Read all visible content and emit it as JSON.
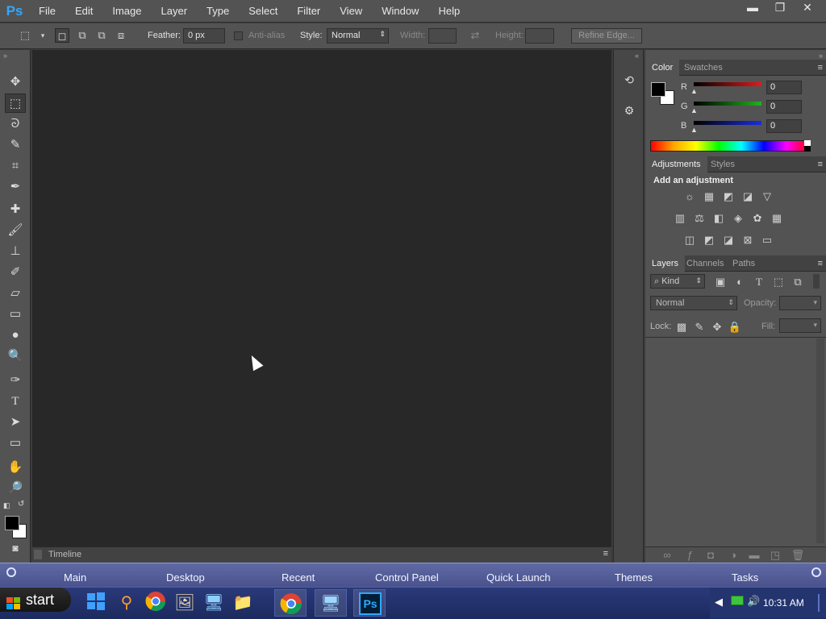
{
  "app": {
    "logo": "Ps"
  },
  "menu": [
    "File",
    "Edit",
    "Image",
    "Layer",
    "Type",
    "Select",
    "Filter",
    "View",
    "Window",
    "Help"
  ],
  "window_controls": {
    "minimize": "▬",
    "restore": "❐",
    "close": "✕"
  },
  "options": {
    "feather_label": "Feather:",
    "feather_value": "0 px",
    "antialias_label": "Anti-alias",
    "style_label": "Style:",
    "style_value": "Normal",
    "width_label": "Width:",
    "height_label": "Height:",
    "refine_edge": "Refine Edge..."
  },
  "timeline": {
    "label": "Timeline"
  },
  "color_panel": {
    "tabs": [
      "Color",
      "Swatches"
    ],
    "channels": [
      {
        "name": "R",
        "value": "0",
        "color": "#e21a1a"
      },
      {
        "name": "G",
        "value": "0",
        "color": "#22b11c"
      },
      {
        "name": "B",
        "value": "0",
        "color": "#1a2de0"
      }
    ]
  },
  "adjustments_panel": {
    "tabs": [
      "Adjustments",
      "Styles"
    ],
    "heading": "Add an adjustment"
  },
  "layers_panel": {
    "tabs": [
      "Layers",
      "Channels",
      "Paths"
    ],
    "kind_label": "Kind",
    "blend_mode": "Normal",
    "opacity_label": "Opacity:",
    "lock_label": "Lock:",
    "fill_label": "Fill:"
  },
  "launcher": [
    "Main",
    "Desktop",
    "Recent",
    "Control Panel",
    "Quick Launch",
    "Themes",
    "Tasks"
  ],
  "taskbar": {
    "start": "start",
    "clock": "10:31 AM"
  },
  "colors": {
    "accent": "#31a8ff",
    "canvas": "#282828",
    "panel": "#535353"
  }
}
